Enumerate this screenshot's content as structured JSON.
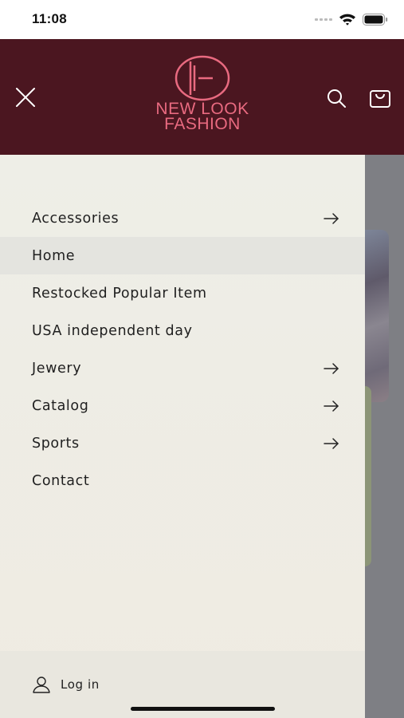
{
  "status_bar": {
    "time": "11:08",
    "icons": [
      "cellular-signal-icon",
      "wifi-icon",
      "battery-icon"
    ]
  },
  "header": {
    "brand_line1": "NEW LOOK",
    "brand_line2": "FASHION",
    "icons": [
      "close-icon",
      "search-icon",
      "cart-icon"
    ],
    "colors": {
      "background": "#4b1620",
      "brand": "#e96a80",
      "icons": "#ffffff"
    }
  },
  "menu": {
    "items": [
      {
        "label": "Accessories",
        "has_submenu": true,
        "active": false
      },
      {
        "label": "Home",
        "has_submenu": false,
        "active": true
      },
      {
        "label": "Restocked Popular Item",
        "has_submenu": false,
        "active": false
      },
      {
        "label": "USA independent day",
        "has_submenu": false,
        "active": false
      },
      {
        "label": "Jewery",
        "has_submenu": true,
        "active": false
      },
      {
        "label": "Catalog",
        "has_submenu": true,
        "active": false
      },
      {
        "label": "Sports",
        "has_submenu": true,
        "active": false
      },
      {
        "label": "Contact",
        "has_submenu": false,
        "active": false
      }
    ]
  },
  "footer": {
    "login_label": "Log in",
    "login_icon": "user-icon"
  }
}
